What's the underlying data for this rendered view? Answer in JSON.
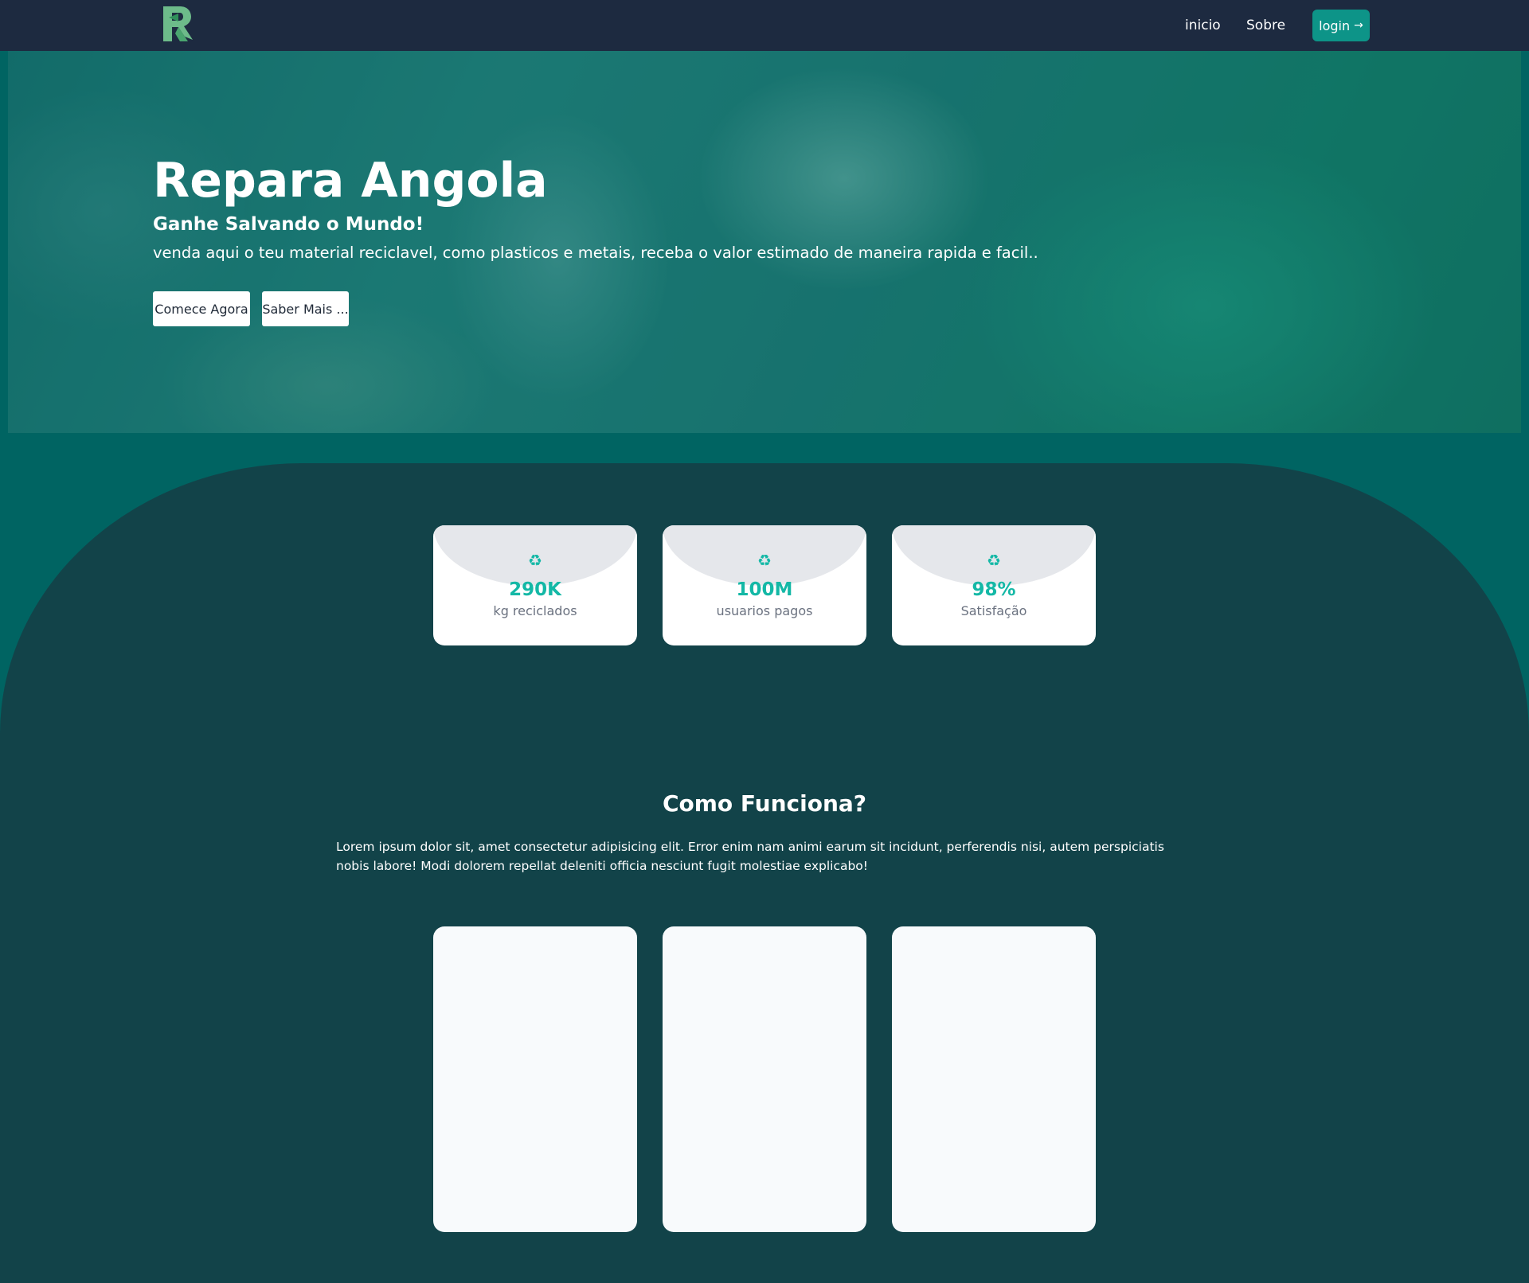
{
  "nav": {
    "links": [
      "inicio",
      "Sobre"
    ],
    "login_label": "login",
    "login_icon": "arrow-right-icon",
    "logo_icon": "r-logo-icon"
  },
  "hero": {
    "title": "Repara Angola",
    "subtitle": "Ganhe Salvando o Mundo!",
    "text": "venda aqui o teu material reciclavel, como plasticos e metais, receba o valor estimado de maneira rapida e facil..",
    "buttons": [
      "Comece Agora",
      "Saber Mais ..."
    ]
  },
  "stats": [
    {
      "icon": "recycle-icon",
      "value": "290K",
      "label": "kg reciclados"
    },
    {
      "icon": "recycle-icon",
      "value": "100M",
      "label": "usuarios pagos"
    },
    {
      "icon": "recycle-icon",
      "value": "98%",
      "label": "Satisfação"
    }
  ],
  "how": {
    "title": "Como Funciona?",
    "text": "Lorem ipsum dolor sit, amet consectetur adipisicing elit. Error enim nam animi earum sit incidunt, perferendis nisi, autem perspiciatis nobis labore! Modi dolorem repellat deleniti officia nesciunt fugit molestiae explicabo!"
  },
  "colors": {
    "navbar": "#1d2a40",
    "accent": "#0d9488",
    "stat_text": "#14b8a6",
    "section_bg": "#124349",
    "page_bg": "#006462"
  }
}
